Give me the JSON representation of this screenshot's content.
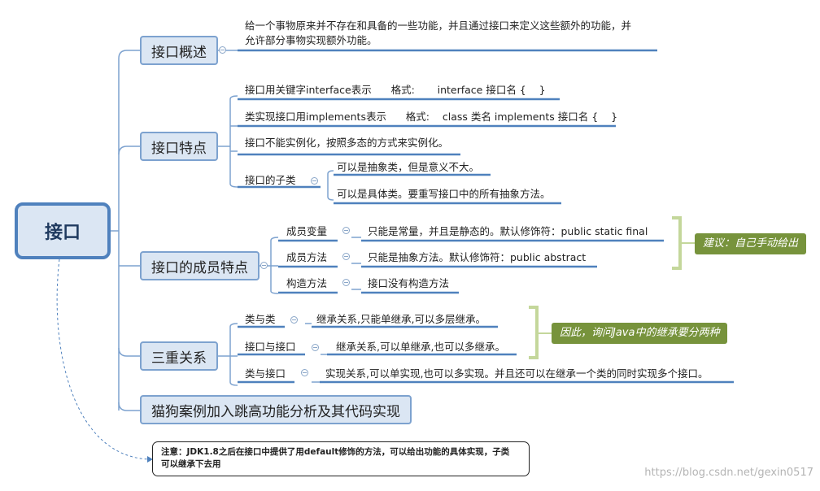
{
  "root": {
    "label": "接口"
  },
  "overview": {
    "label": "接口概述",
    "text_line1": "给一个事物原来并不存在和具备的一些功能，并且通过接口来定义这些额外的功能，并",
    "text_line2": "允许部分事物实现额外功能。"
  },
  "features": {
    "label": "接口特点",
    "keyword": "接口用关键字interface表示      格式:       interface 接口名 {    }",
    "implements": "类实现接口用implements表示      格式:    class 类名 implements 接口名 {    }",
    "no_instance": "接口不能实例化，按照多态的方式来实例化。",
    "subclass_label": "接口的子类",
    "subclass_abstract": "可以是抽象类，但是意义不大。",
    "subclass_concrete": "可以是具体类。要重写接口中的所有抽象方法。"
  },
  "members": {
    "label": "接口的成员特点",
    "variable_label": "成员变量",
    "variable_text": "只能是常量，并且是静态的。默认修饰符：public static final",
    "method_label": "成员方法",
    "method_text": "只能是抽象方法。默认修饰符：public abstract",
    "constructor_label": "构造方法",
    "constructor_text": "接口没有构造方法",
    "callout": "建议：自己手动给出"
  },
  "relations": {
    "label": "三重关系",
    "class_class_label": "类与类",
    "class_class_text": "继承关系,只能单继承,可以多层继承。",
    "iface_iface_label": "接口与接口",
    "iface_iface_text": "继承关系,可以单继承,也可以多继承。",
    "class_iface_label": "类与接口",
    "class_iface_text": "实现关系,可以单实现,也可以多实现。并且还可以在继承一个类的同时实现多个接口。",
    "callout": "因此，询问Java中的继承要分两种"
  },
  "example": {
    "label": "猫狗案例加入跳高功能分析及其代码实现"
  },
  "note": {
    "line1": "注意：JDK1.8之后在接口中提供了用default修饰的方法，可以给出功能的具体实现，子类",
    "line2": "可以继承下去用"
  },
  "watermark": "https://blog.csdn.net/gexin0517",
  "colors": {
    "node_fill": "#dbe6f3",
    "node_border": "#7da2cf",
    "root_border": "#4f81bd",
    "line": "#4f81bd",
    "callout": "#77933c",
    "bracket": "#c4d79b"
  }
}
